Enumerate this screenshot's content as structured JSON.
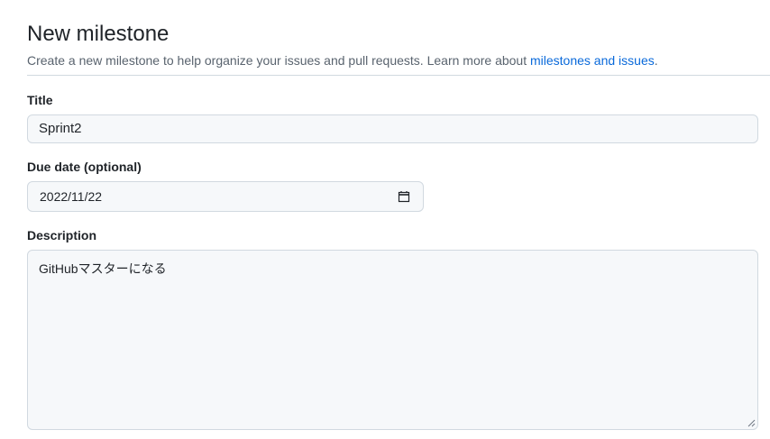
{
  "header": {
    "title": "New milestone",
    "subtitle_text": "Create a new milestone to help organize your issues and pull requests. Learn more about ",
    "subtitle_link": "milestones and issues",
    "subtitle_end": "."
  },
  "form": {
    "title_label": "Title",
    "title_value": "Sprint2",
    "due_date_label": "Due date (optional)",
    "due_date_value": "2022/11/22",
    "description_label": "Description",
    "description_value": "GitHubマスターになる"
  },
  "icons": {
    "calendar": "calendar-icon",
    "resize": "resize-handle-icon"
  },
  "colors": {
    "link": "#0969da",
    "input_bg": "#f6f8fa",
    "border": "#d1d9e0"
  }
}
